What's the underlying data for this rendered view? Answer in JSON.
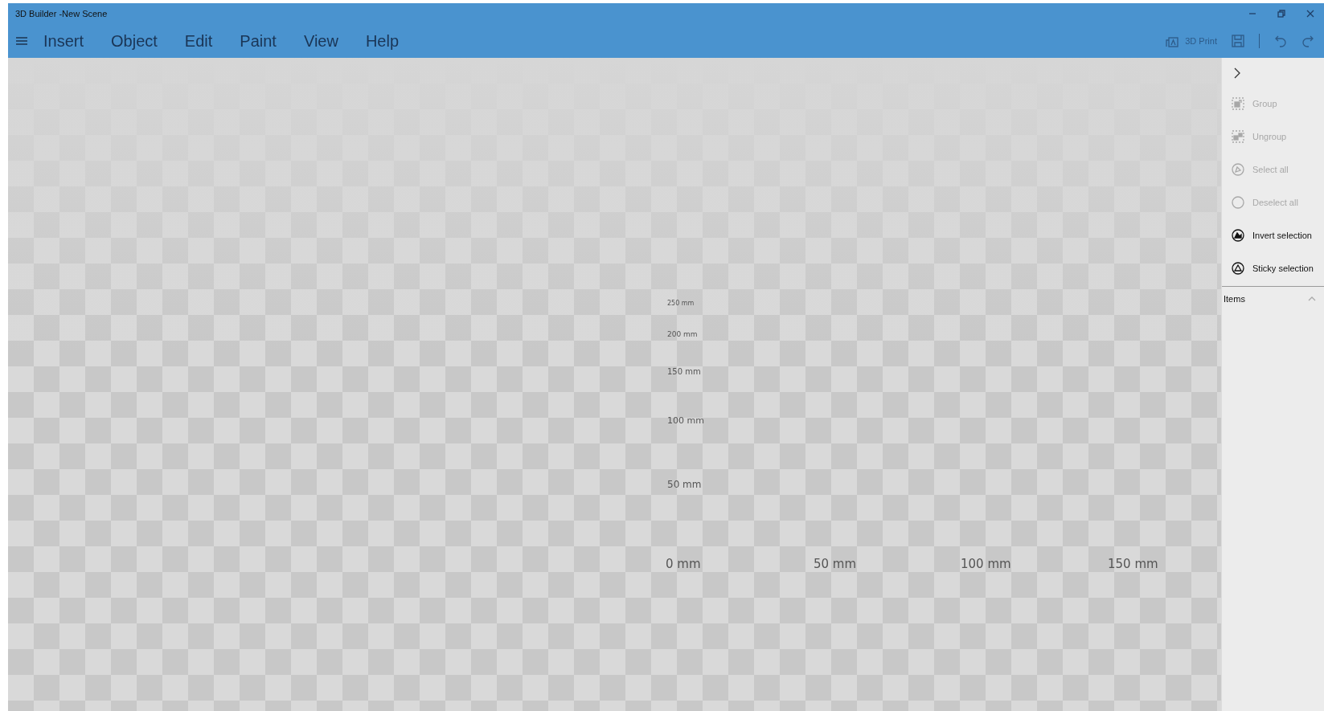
{
  "window": {
    "title": "3D Builder -New Scene"
  },
  "menu": [
    {
      "label": "Insert"
    },
    {
      "label": "Object"
    },
    {
      "label": "Edit"
    },
    {
      "label": "Paint"
    },
    {
      "label": "View"
    },
    {
      "label": "Help"
    }
  ],
  "toolbar": {
    "print_label": "3D Print"
  },
  "viewport": {
    "vertical_ruler": [
      "250 mm",
      "200 mm",
      "150 mm",
      "100 mm",
      "50 mm"
    ],
    "horizontal_ruler": [
      "0 mm",
      "50 mm",
      "100 mm",
      "150 mm"
    ]
  },
  "side_panel": {
    "items": [
      {
        "label": "Group",
        "disabled": true
      },
      {
        "label": "Ungroup",
        "disabled": true
      },
      {
        "label": "Select all",
        "disabled": true
      },
      {
        "label": "Deselect all",
        "disabled": true
      },
      {
        "label": "Invert selection",
        "disabled": false
      },
      {
        "label": "Sticky selection",
        "disabled": false
      }
    ],
    "section": {
      "label": "Items",
      "expanded": true
    }
  }
}
